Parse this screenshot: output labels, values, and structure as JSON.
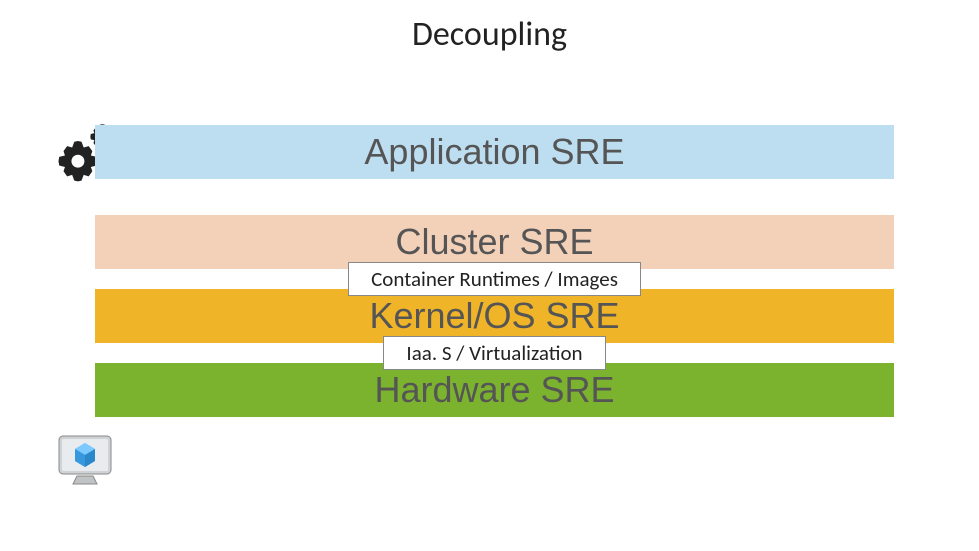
{
  "title": "Decoupling",
  "layers": {
    "app": "Application SRE",
    "cluster": "Cluster SRE",
    "kernel": "Kernel/OS SRE",
    "hardware": "Hardware SRE"
  },
  "interfaces": {
    "container": "Container Runtimes / Images",
    "iaas": "Iaa. S / Virtualization"
  },
  "icons": {
    "gears": "gears-icon",
    "monitor": "monitor-cube-icon"
  },
  "colors": {
    "app": "#bcdef0",
    "cluster": "#f3d0b8",
    "kernel": "#f0b429",
    "hardware": "#7cb32e"
  }
}
